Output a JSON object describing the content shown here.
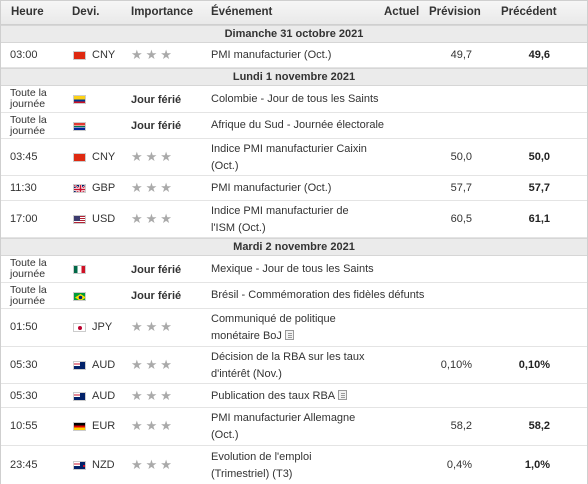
{
  "header": {
    "time": "Heure",
    "currency": "Devi.",
    "importance": "Importance",
    "event": "Événement",
    "actual": "Actuel",
    "forecast": "Prévision",
    "previous": "Précédent"
  },
  "days": [
    "Dimanche 31 octobre 2021",
    "Lundi 1 novembre 2021",
    "Mardi 2 novembre 2021"
  ],
  "rows": [
    {
      "time": "03:00",
      "flag": "china-flag-icon",
      "currency": "CNY",
      "stars": "★★★",
      "event": "PMI manufacturier (Oct.)",
      "forecast": "49,7",
      "previous": "49,6"
    },
    {
      "time_l1": "Toute la",
      "time_l2": "journée",
      "flag": "colombia-flag-icon",
      "holiday": "Jour férié",
      "event": "Colombie - Jour de tous les Saints"
    },
    {
      "time_l1": "Toute la",
      "time_l2": "journée",
      "flag": "south-africa-flag-icon",
      "holiday": "Jour férié",
      "event": "Afrique du Sud - Journée électorale"
    },
    {
      "time": "03:45",
      "flag": "china-flag-icon",
      "currency": "CNY",
      "stars": "★★★",
      "event_l1": "Indice PMI manufacturier Caixin",
      "event_l2": "(Oct.)",
      "forecast": "50,0",
      "previous": "50,0"
    },
    {
      "time": "11:30",
      "flag": "uk-flag-icon",
      "currency": "GBP",
      "stars": "★★★",
      "event": "PMI manufacturier (Oct.)",
      "forecast": "57,7",
      "previous": "57,7"
    },
    {
      "time": "17:00",
      "flag": "us-flag-icon",
      "currency": "USD",
      "stars": "★★★",
      "event_l1": "Indice PMI manufacturier de",
      "event_l2": "l'ISM (Oct.)",
      "forecast": "60,5",
      "previous": "61,1"
    },
    {
      "time_l1": "Toute la",
      "time_l2": "journée",
      "flag": "mexico-flag-icon",
      "holiday": "Jour férié",
      "event": "Mexique - Jour de tous les Saints"
    },
    {
      "time_l1": "Toute la",
      "time_l2": "journée",
      "flag": "brazil-flag-icon",
      "holiday": "Jour férié",
      "event": "Brésil - Commémoration des fidèles défunts"
    },
    {
      "time": "01:50",
      "flag": "japan-flag-icon",
      "currency": "JPY",
      "stars": "★★★",
      "event_l1": "Communiqué de politique",
      "event_l2": "monétaire BoJ"
    },
    {
      "time": "05:30",
      "flag": "australia-flag-icon",
      "currency": "AUD",
      "stars": "★★★",
      "event_l1": "Décision de la RBA sur les taux",
      "event_l2": "d'intérêt (Nov.)",
      "forecast": "0,10%",
      "previous": "0,10%"
    },
    {
      "time": "05:30",
      "flag": "australia-flag-icon",
      "currency": "AUD",
      "stars": "★★★",
      "event": "Publication des taux RBA"
    },
    {
      "time": "10:55",
      "flag": "germany-flag-icon",
      "currency": "EUR",
      "stars": "★★★",
      "event_l1": "PMI manufacturier Allemagne",
      "event_l2": "(Oct.)",
      "forecast": "58,2",
      "previous": "58,2"
    },
    {
      "time": "23:45",
      "flag": "new-zealand-flag-icon",
      "currency": "NZD",
      "stars": "★★★",
      "event_l1": "Evolution de l'emploi",
      "event_l2": "(Trimestriel) (T3)",
      "forecast": "0,4%",
      "previous": "1,0%"
    }
  ]
}
